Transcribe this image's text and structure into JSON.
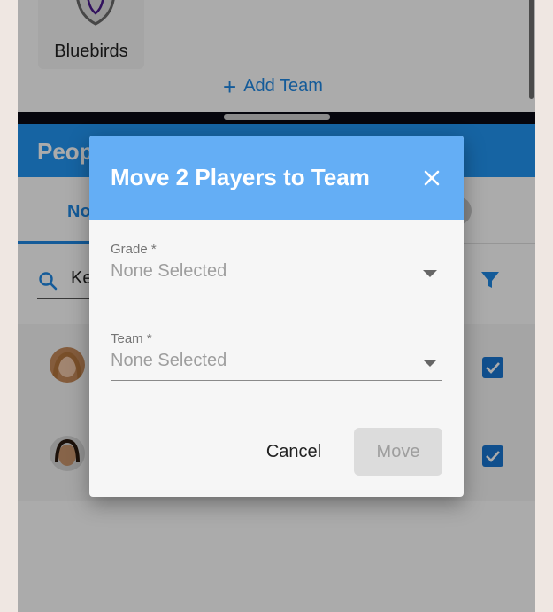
{
  "background_page": {
    "team_card": {
      "name": "Bluebirds",
      "logo_icon": "shield-icon"
    },
    "add_team": {
      "label": "Add Team",
      "icon": "plus-icon"
    },
    "people_header": {
      "title": "Peop"
    },
    "tabs": {
      "active_label": "No"
    },
    "search": {
      "value": "Ke",
      "icon": "search-icon",
      "filter_icon": "filter-icon"
    },
    "players": [
      {
        "avatar": "avatar-1",
        "checked": true
      },
      {
        "avatar": "avatar-2",
        "checked": true
      }
    ]
  },
  "dialog": {
    "title": "Move 2 Players to Team",
    "close_icon": "close-icon",
    "grade": {
      "label": "Grade *",
      "value": "None Selected"
    },
    "team": {
      "label": "Team *",
      "value": "None Selected"
    },
    "cancel_label": "Cancel",
    "move_label": "Move"
  },
  "colors": {
    "primary": "#2196f3",
    "dialog_header": "#64aef5",
    "disabled_button": "#dcdcdc"
  }
}
